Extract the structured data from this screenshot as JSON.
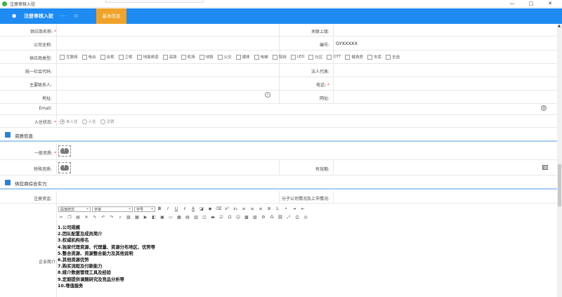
{
  "window": {
    "title": "注册审核入驻",
    "minimize": "—",
    "maximize": "□",
    "close": "✕"
  },
  "navbar": {
    "title": "注册审核入驻",
    "more": "···",
    "tab": "基本信息"
  },
  "basic": {
    "supplier_name_label": "供应商名称:",
    "related_parent_label": "关联上级:",
    "company_fullname_label": "公司全称:",
    "code_label": "编号:",
    "code_value": "GYXXXXX",
    "supplier_type_label": "供应商类型:",
    "supplier_types": [
      "互联网",
      "电台",
      "央视",
      "卫视",
      "地面频道",
      "高铁",
      "机场",
      "地铁",
      "公交",
      "媒体",
      "电梯",
      "院线",
      "LED",
      "社区",
      "OTT",
      "健身房",
      "车库",
      "全选"
    ],
    "credit_code_label": "统一社会代码:",
    "legal_rep_label": "法人代表:",
    "contact_label": "主要联系人:",
    "phone_label": "电话:",
    "address_label": "地址:",
    "website_label": "网址:",
    "email_label": "Email:",
    "status_label": "入住状态:",
    "status_options": [
      "未入住",
      "入住",
      "注销"
    ]
  },
  "qualification": {
    "title": "资质信息",
    "general_label": "一般资质:",
    "special_label": "特殊资质:",
    "validity_label": "有效期:"
  },
  "strength": {
    "title": "供应商综合实力",
    "capital_label": "注册资金:",
    "branch_label": "分子公司情况及上市情况:",
    "intro_label": "企业简介:",
    "editor": {
      "style_select": "段落样式",
      "font_select": "字体",
      "size_select": "字号"
    },
    "intro_lines": [
      "1.公司规模",
      "2.团队配置及成员简介",
      "3.权威机构排名",
      "4.独家代理资源、代理量、资源分布地区、优势等",
      "5.整合资源、资源整合能力及其他说明",
      "6.其他资源优势",
      "7.购买流程及付款能力",
      "8.媒介数据管理工具及经验",
      "9.定期提供课题研究及竞品分析等",
      "10.增值服务"
    ]
  },
  "colors": {
    "nav": "#1d8bf1",
    "tab": "#f0a32a",
    "section_line": "#a5ccf2"
  }
}
